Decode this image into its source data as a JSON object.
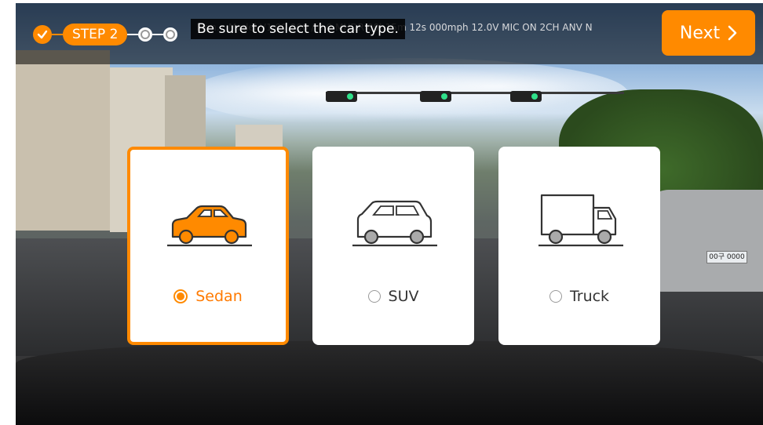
{
  "topbar": {
    "step_label": "STEP 2",
    "ghost_text": "Firm... Model V1.00.000 / 0.0 MHDR 00h15m 12s 000mph 12.0V MIC ON 2CH ANV N",
    "message": "Be sure to select the car type.",
    "next_label": "Next",
    "next_icon": "chevron-right-icon"
  },
  "background": {
    "license_plate": "00구 0000"
  },
  "car_types": [
    {
      "label": "Sedan",
      "icon": "sedan-icon",
      "selected": true
    },
    {
      "label": "SUV",
      "icon": "suv-icon",
      "selected": false
    },
    {
      "label": "Truck",
      "icon": "truck-icon",
      "selected": false
    }
  ],
  "colors": {
    "accent": "#ff8a00",
    "card_bg": "#ffffff",
    "icon_stroke": "#333333"
  }
}
